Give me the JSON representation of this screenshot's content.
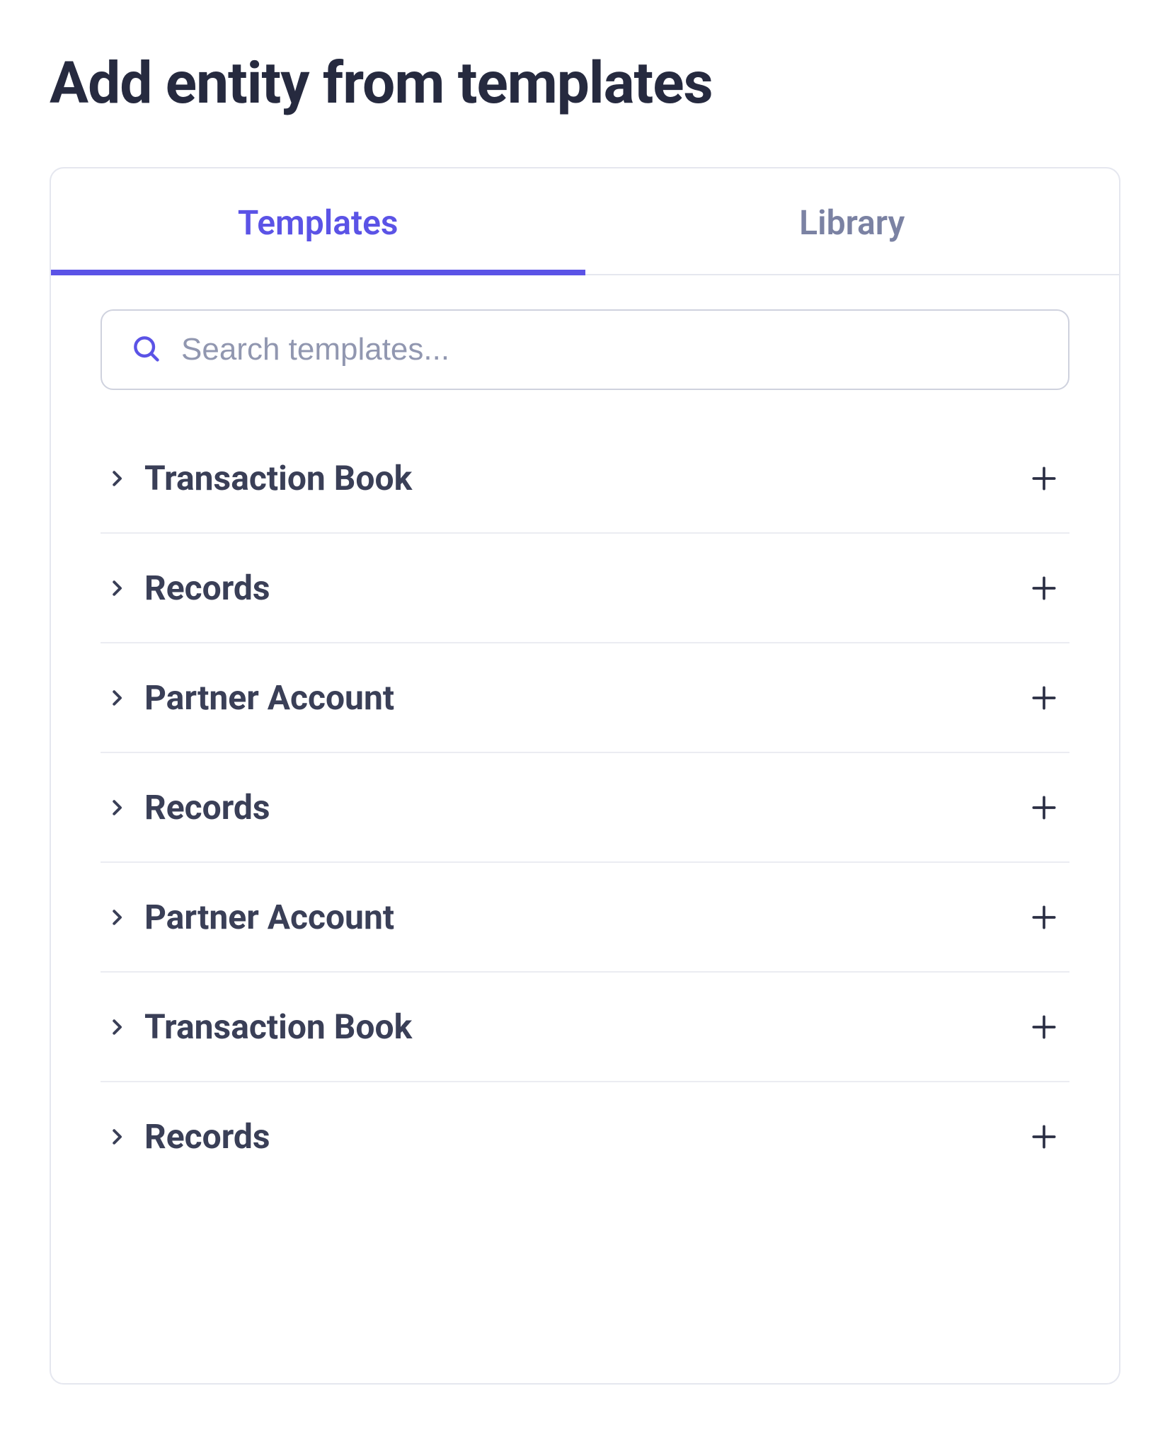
{
  "title": "Add entity from templates",
  "tabs": [
    {
      "label": "Templates",
      "active": true
    },
    {
      "label": "Library",
      "active": false
    }
  ],
  "search": {
    "placeholder": "Search templates..."
  },
  "templates": [
    {
      "name": "Transaction Book"
    },
    {
      "name": "Records"
    },
    {
      "name": "Partner Account"
    },
    {
      "name": "Records"
    },
    {
      "name": "Partner Account"
    },
    {
      "name": "Transaction Book"
    },
    {
      "name": "Records"
    }
  ],
  "colors": {
    "accent": "#5b53e6"
  }
}
